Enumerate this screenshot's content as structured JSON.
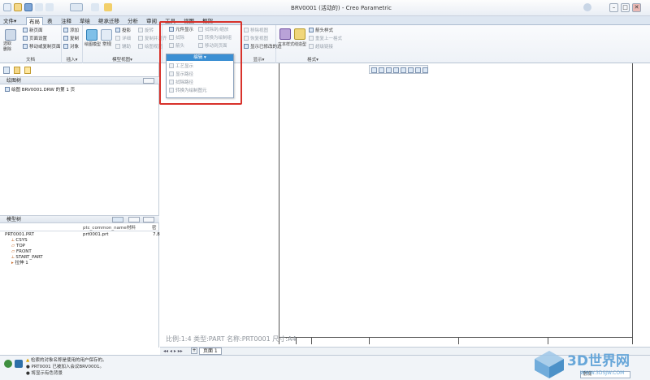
{
  "window": {
    "title": "BRV0001 (活动的) - Creo Parametric",
    "min": "–",
    "max": "□",
    "close": "✕"
  },
  "tabs": [
    "文件▾",
    "布局",
    "表",
    "注释",
    "草绘",
    "继承迁移",
    "分析",
    "审阅",
    "工具",
    "视图",
    "框架"
  ],
  "ribbon": {
    "doc": {
      "label": "文档",
      "items": [
        "新页面",
        "页面设置",
        "移动或复制页面"
      ],
      "big": "选取\n删除"
    },
    "insert": {
      "label": "插入▾",
      "items": [
        "添加",
        "复制",
        "对象"
      ]
    },
    "views": {
      "label": "模型视图▾",
      "big1": "绘图模型",
      "big2": "常规",
      "items": [
        "投影",
        "旋转",
        "详细",
        "复制并对齐",
        "辅助",
        "绘图视图"
      ]
    },
    "edit": {
      "items": [
        "元件显示",
        "拭除",
        "箭头",
        "拭除剖/缩放",
        "转换为绘制组",
        "移动到页面"
      ]
    },
    "display": {
      "label": "显示▾",
      "items": [
        "移除视图",
        "恢复视图",
        "显示已修改的边"
      ]
    },
    "format": {
      "label": "格式▾",
      "big1": "文本样式",
      "big2": "线造型",
      "items": [
        "箭头样式",
        "重复上一格式",
        "超级链接"
      ]
    }
  },
  "dropdown": {
    "header": "编辑 ▾",
    "items": [
      "工艺显示",
      "显示路径",
      "拭除路径",
      "转换为绘制图元"
    ]
  },
  "drawing_tree": {
    "title": "绘图树",
    "items": [
      "绘图 BRV0001.DRW 的第 1 页"
    ]
  },
  "model_tree": {
    "title": "模型树",
    "columns": [
      "ptc_common_name",
      "材料",
      "密"
    ],
    "rows": [
      {
        "name": "PRT0001.PRT",
        "common": "prt0001.prt",
        "extra": "7.8"
      },
      {
        "name": "CSYS"
      },
      {
        "name": "TOP"
      },
      {
        "name": "FRONT"
      },
      {
        "name": "START_PART"
      },
      {
        "name": "拉伸 1"
      }
    ]
  },
  "canvas": {
    "info": "比例:1:4      类型:PART      名称:PRT0001      尺寸:A4",
    "page": "页面 1"
  },
  "status": {
    "messages": [
      "检索的对象名称是使用的用户保存的。",
      "● PRT0001 已被加入会议BRV0001。",
      "● 将显示有色背景"
    ],
    "filter": "常规"
  },
  "watermark": {
    "title": "3D世界网",
    "url": "WWW.3DSJW.COM"
  },
  "colors": {
    "accent": "#3b8fd3",
    "highlight": "#d8322b"
  }
}
